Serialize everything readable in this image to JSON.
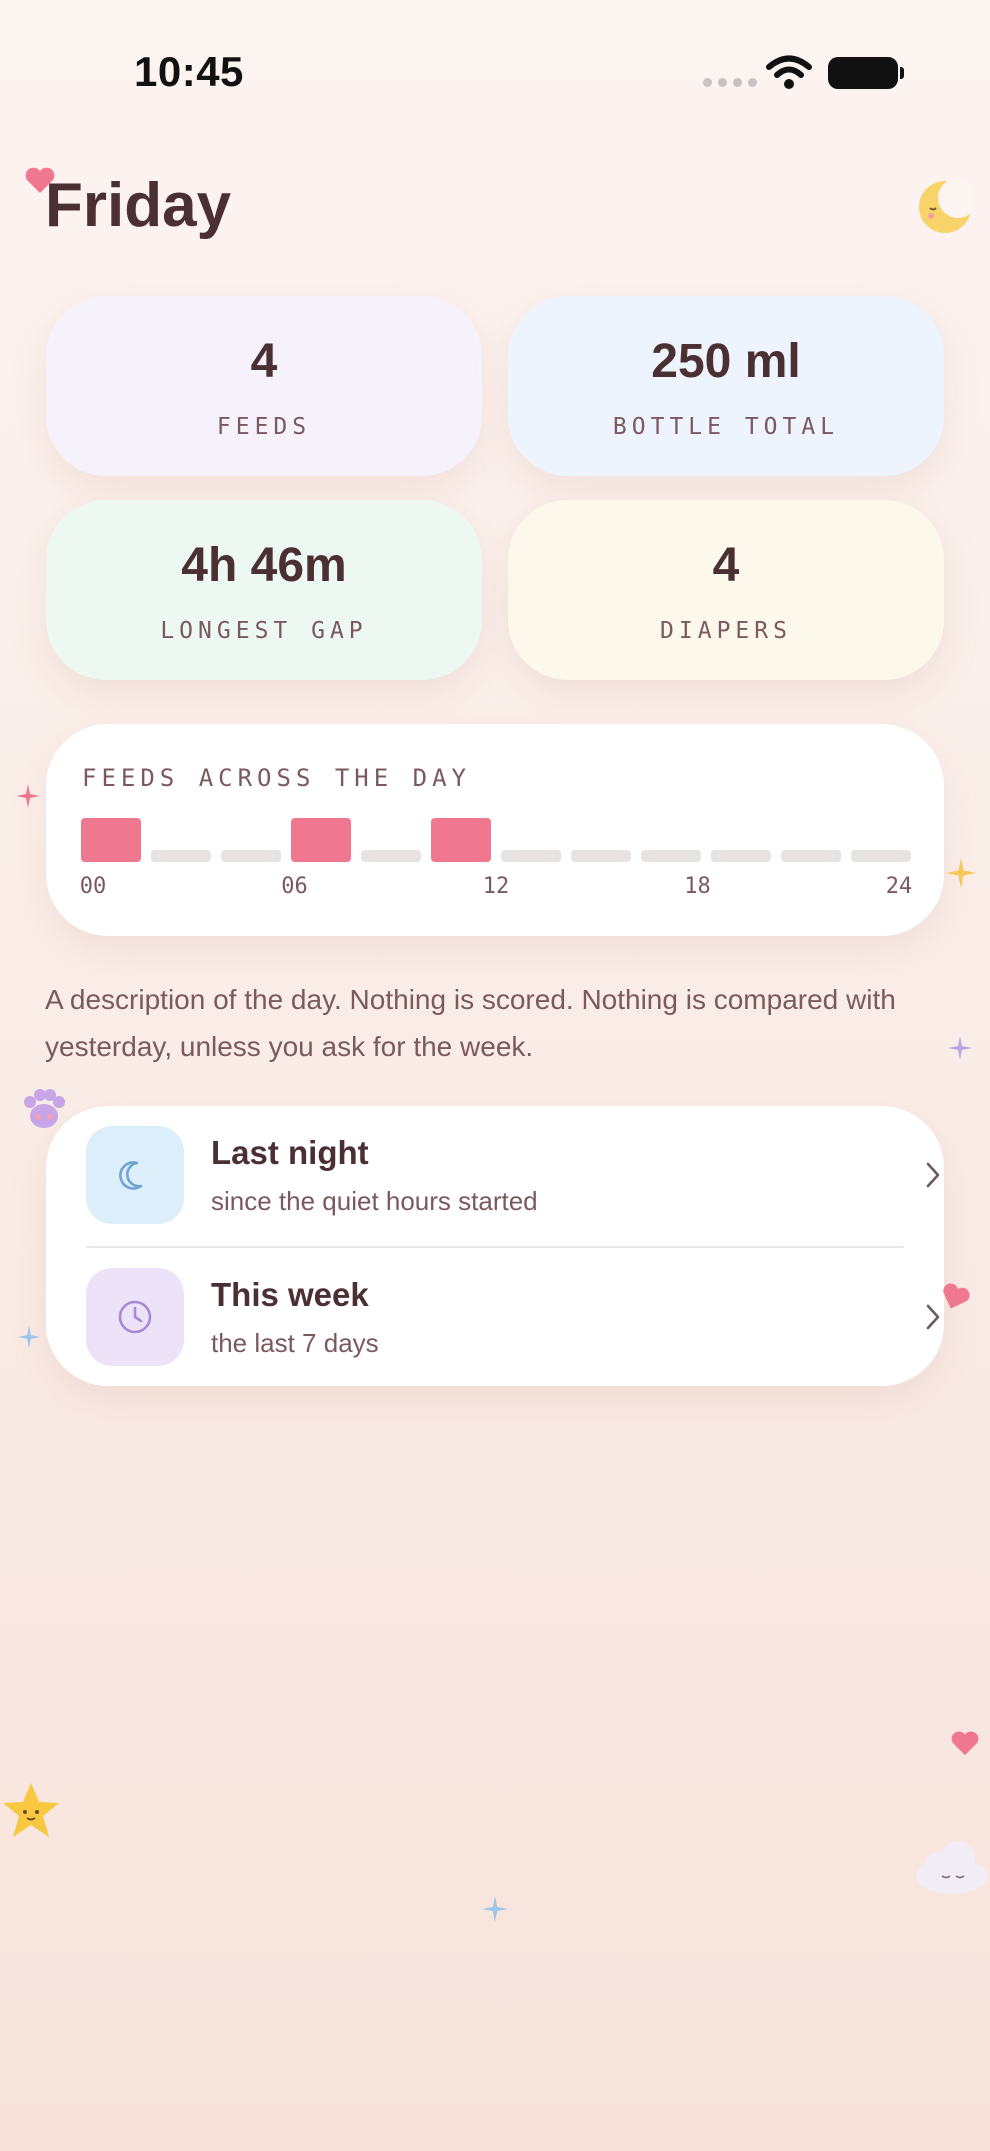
{
  "status_bar": {
    "time": "10:45"
  },
  "header": {
    "title": "Friday"
  },
  "stats": [
    {
      "value": "4",
      "label": "FEEDS",
      "color": "#f5f2fb"
    },
    {
      "value": "250 ml",
      "label": "BOTTLE TOTAL",
      "color": "#eef4fd"
    },
    {
      "value": "4h 46m",
      "label": "LONGEST GAP",
      "color": "#eef8f3"
    },
    {
      "value": "4",
      "label": "DIAPERS",
      "color": "#fdf8ec"
    }
  ],
  "chart_data": {
    "type": "bar",
    "title": "FEEDS ACROSS THE DAY",
    "x_ticks": [
      "00",
      "06",
      "12",
      "18",
      "24"
    ],
    "bins": [
      "00-02",
      "02-04",
      "04-06",
      "06-08",
      "08-10",
      "10-12",
      "12-14",
      "14-16",
      "16-18",
      "18-20",
      "20-22",
      "22-24"
    ],
    "values": [
      1,
      0,
      0,
      1,
      0,
      1,
      0,
      0,
      0,
      0,
      0,
      0
    ],
    "xlim": [
      0,
      24
    ],
    "active_color": "#f07790",
    "inactive_color": "#e8e3e3"
  },
  "description": "A description of the day. Nothing is scored. Nothing is compared with yesterday, unless you ask for the week.",
  "nav": [
    {
      "title": "Last night",
      "subtitle": "since the quiet hours started",
      "icon": "moon-icon",
      "icon_bg": "#ddeefb",
      "icon_color": "#6fa3d0"
    },
    {
      "title": "This week",
      "subtitle": "the last 7 days",
      "icon": "clock-icon",
      "icon_bg": "#ece3f8",
      "icon_color": "#a68ad6"
    }
  ]
}
